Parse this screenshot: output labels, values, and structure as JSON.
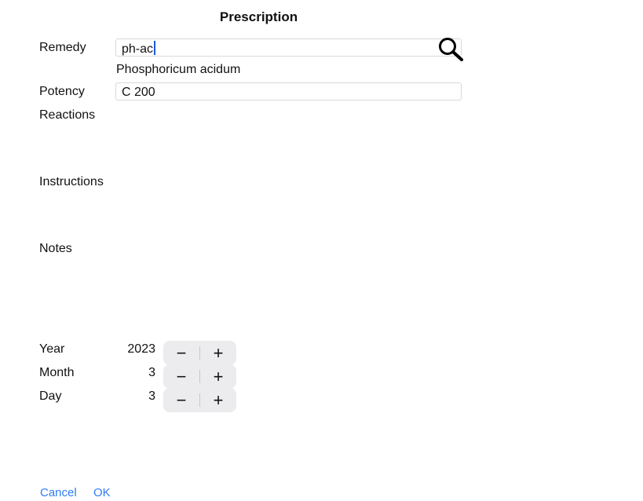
{
  "header": {
    "title": "Prescription"
  },
  "form": {
    "remedy_label": "Remedy",
    "remedy_value": "ph-ac",
    "remedy_match": "Phosphoricum acidum",
    "potency_label": "Potency",
    "potency_value": "C 200",
    "reactions_label": "Reactions",
    "instructions_label": "Instructions",
    "notes_label": "Notes"
  },
  "date": {
    "year_label": "Year",
    "year_value": "2023",
    "month_label": "Month",
    "month_value": "3",
    "day_label": "Day",
    "day_value": "3",
    "minus_symbol": "−",
    "plus_symbol": "+"
  },
  "footer": {
    "cancel_label": "Cancel",
    "ok_label": "OK"
  },
  "colors": {
    "accent": "#2f7bf5",
    "caret": "#1a55e8"
  },
  "icons": {
    "search": "search-icon"
  }
}
